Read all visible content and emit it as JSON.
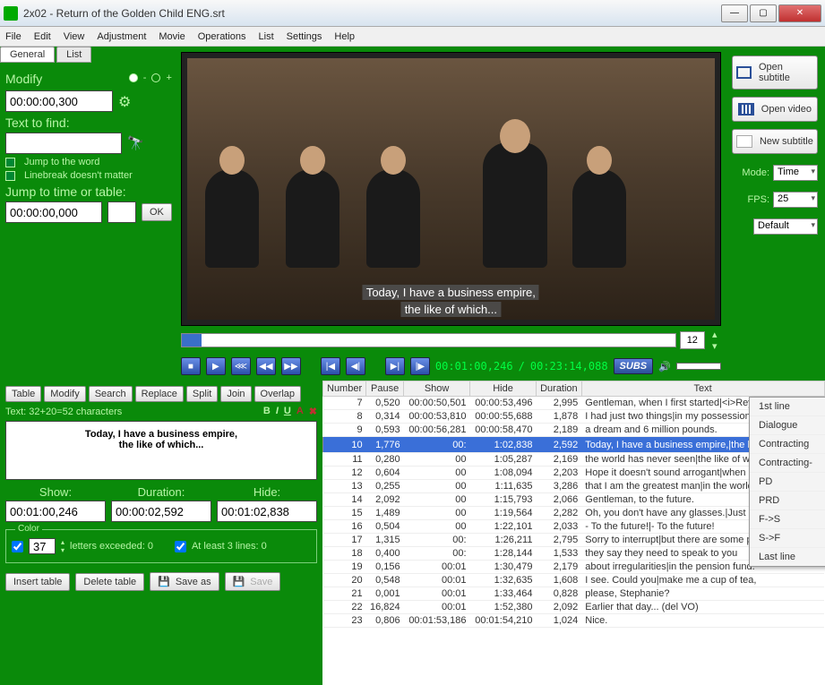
{
  "window": {
    "title": "2x02 - Return of the Golden Child ENG.srt"
  },
  "menu": [
    "File",
    "Edit",
    "View",
    "Adjustment",
    "Movie",
    "Operations",
    "List",
    "Settings",
    "Help"
  ],
  "tabs": {
    "general": "General",
    "list": "List"
  },
  "modify": {
    "label": "Modify",
    "value": "00:00:00,300",
    "plus": "+",
    "minus": "-"
  },
  "find": {
    "label": "Text to find:",
    "value": "",
    "jump": "Jump to the word",
    "linebreak": "Linebreak doesn't matter"
  },
  "jump": {
    "label": "Jump to time or table:",
    "value": "00:00:00,000",
    "ok": "OK"
  },
  "sub": {
    "l1": "Today, I have a business empire,",
    "l2": "the like of which..."
  },
  "seek": {
    "val": "12"
  },
  "time": {
    "cur": "00:01:00,246",
    "total": "00:23:14,088",
    "sep": " / "
  },
  "subs_btn": "SUBS",
  "right": {
    "open_sub": "Open subtitle",
    "open_vid": "Open video",
    "new_sub": "New subtitle",
    "mode_l": "Mode:",
    "mode_v": "Time",
    "fps_l": "FPS:",
    "fps_v": "25",
    "def": "Default"
  },
  "bl_tabs": [
    "Table",
    "Modify",
    "Search",
    "Replace",
    "Split",
    "Join",
    "Overlap"
  ],
  "chars": "Text: 32+20=52 characters",
  "fmt": {
    "b": "B",
    "i": "I",
    "u": "U"
  },
  "editor": {
    "l1": "Today, I have a business empire,",
    "l2": "the like of which..."
  },
  "sdh": {
    "show_l": "Show:",
    "show_v": "00:01:00,246",
    "dur_l": "Duration:",
    "dur_v": "00:00:02,592",
    "hide_l": "Hide:",
    "hide_v": "00:01:02,838"
  },
  "color": {
    "leg": "Color",
    "num": "37",
    "letters": "letters exceeded:  0",
    "atleast": "At least 3 lines:    0"
  },
  "bl_btns": {
    "ins": "Insert table",
    "del": "Delete table",
    "saveas": "Save as",
    "save": "Save"
  },
  "cols": [
    "Number",
    "Pause",
    "Show",
    "Hide",
    "Duration",
    "Text"
  ],
  "rows": [
    {
      "n": "7",
      "p": "0,520",
      "s": "00:00:50,501",
      "h": "00:00:53,496",
      "d": "2,995",
      "t": "Gentleman, when I first started|<i>Reynholm Industrie"
    },
    {
      "n": "8",
      "p": "0,314",
      "s": "00:00:53,810",
      "h": "00:00:55,688",
      "d": "1,878",
      "t": "I had just two things|in my possession:"
    },
    {
      "n": "9",
      "p": "0,593",
      "s": "00:00:56,281",
      "h": "00:00:58,470",
      "d": "2,189",
      "t": "a dream and 6 million pounds."
    },
    {
      "n": "10",
      "p": "1,776",
      "s": "00:",
      "h": "1:02,838",
      "d": "2,592",
      "t": "Today, I have a business empire,|the like of which...",
      "sel": true
    },
    {
      "n": "11",
      "p": "0,280",
      "s": "00",
      "h": "1:05,287",
      "d": "2,169",
      "t": "the world has never seen|the like of which."
    },
    {
      "n": "12",
      "p": "0,604",
      "s": "00",
      "h": "1:08,094",
      "d": "2,203",
      "t": "Hope it doesn't sound arrogant|when I say..."
    },
    {
      "n": "13",
      "p": "0,255",
      "s": "00",
      "h": "1:11,635",
      "d": "3,286",
      "t": "that I am the greatest man|in the world!"
    },
    {
      "n": "14",
      "p": "2,092",
      "s": "00",
      "h": "1:15,793",
      "d": "2,066",
      "t": "Gentleman, to the future."
    },
    {
      "n": "15",
      "p": "1,489",
      "s": "00",
      "h": "1:19,564",
      "d": "2,282",
      "t": "Oh, you don't have any glasses.|Just pretend."
    },
    {
      "n": "16",
      "p": "0,504",
      "s": "00",
      "h": "1:22,101",
      "d": "2,033",
      "t": "- To the future!|- To the future!"
    },
    {
      "n": "17",
      "p": "1,315",
      "s": "00:",
      "h": "1:26,211",
      "d": "2,795",
      "t": "Sorry to interrupt|but there are some policemen here,"
    },
    {
      "n": "18",
      "p": "0,400",
      "s": "00:",
      "h": "1:28,144",
      "d": "1,533",
      "t": "they say they need to speak to you"
    },
    {
      "n": "19",
      "p": "0,156",
      "s": "00:01",
      "h": "1:30,479",
      "d": "2,179",
      "t": "about irregularities|in the pension fund."
    },
    {
      "n": "20",
      "p": "0,548",
      "s": "00:01",
      "h": "1:32,635",
      "d": "1,608",
      "t": "I see. Could you|make me a cup of tea,"
    },
    {
      "n": "21",
      "p": "0,001",
      "s": "00:01",
      "h": "1:33,464",
      "d": "0,828",
      "t": "please, Stephanie?"
    },
    {
      "n": "22",
      "p": "16,824",
      "s": "00:01",
      "h": "1:52,380",
      "d": "2,092",
      "t": "Earlier that day... (del VO)"
    },
    {
      "n": "23",
      "p": "0,806",
      "s": "00:01:53,186",
      "h": "00:01:54,210",
      "d": "1,024",
      "t": "Nice."
    }
  ],
  "ctx": [
    "1st line",
    "Dialogue",
    "Contracting",
    "Contracting-",
    "PD",
    "PRD",
    "F->S",
    "S->F",
    "Last line"
  ]
}
